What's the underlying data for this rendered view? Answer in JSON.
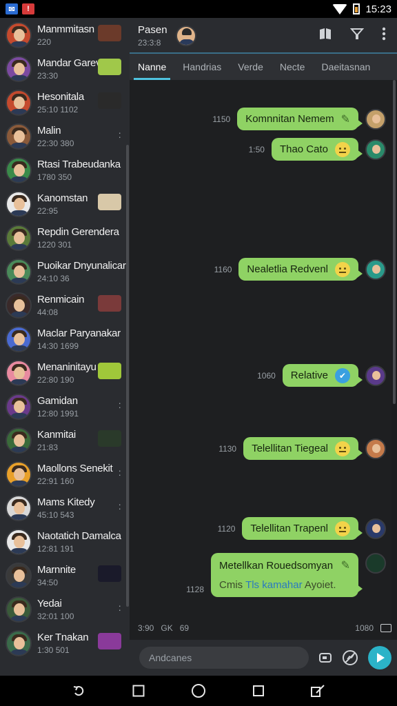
{
  "status_bar": {
    "time": "15:23"
  },
  "sidebar": {
    "chats": [
      {
        "name": "Manmmitasn",
        "meta": "220",
        "avatar_color": "#c44a2e",
        "thumb": "#6b3a2a",
        "dots": false
      },
      {
        "name": "Mandar Garev",
        "meta": "23:30",
        "avatar_color": "#7b4aa0",
        "thumb": "#a0c84a",
        "dots": false
      },
      {
        "name": "Hesonitala",
        "meta": "25:10 1102",
        "avatar_color": "#c44a2e",
        "thumb": "#2a2a2a",
        "dots": false
      },
      {
        "name": "Malin",
        "meta": "22:30 380",
        "avatar_color": "#8a5a3a",
        "thumb": "",
        "dots": true
      },
      {
        "name": "Rtasi Trabeudanka",
        "meta": "1780 350",
        "avatar_color": "#3a8a4a",
        "thumb": "",
        "dots": false
      },
      {
        "name": "Kanomstan",
        "meta": "22:95",
        "avatar_color": "#e8e8e8",
        "thumb": "#d8c8a8",
        "dots": false
      },
      {
        "name": "Repdin Gerendera",
        "meta": "1220 301",
        "avatar_color": "#5a7a3a",
        "thumb": "",
        "dots": false
      },
      {
        "name": "Puoikar Dnyunalicar",
        "meta": "24:10 36",
        "avatar_color": "#4a8a5a",
        "thumb": "",
        "dots": false
      },
      {
        "name": "Renmicain",
        "meta": "44:08",
        "avatar_color": "#3a2a2a",
        "thumb": "#7a3a3a",
        "dots": false
      },
      {
        "name": "Maclar Paryanakar",
        "meta": "14:30 1699",
        "avatar_color": "#4a6ad0",
        "thumb": "",
        "dots": false
      },
      {
        "name": "Menaninitayu",
        "meta": "22:80 190",
        "avatar_color": "#e88aa0",
        "thumb": "#a0c83a",
        "dots": false
      },
      {
        "name": "Gamidan",
        "meta": "12:80 1991",
        "avatar_color": "#6a3a8a",
        "thumb": "",
        "dots": true
      },
      {
        "name": "Kanmitai",
        "meta": "21:83",
        "avatar_color": "#3a6a3a",
        "thumb": "#2a3a2a",
        "dots": false
      },
      {
        "name": "Maollons Senekit",
        "meta": "22:91 160",
        "avatar_color": "#e8a02a",
        "thumb": "",
        "dots": true
      },
      {
        "name": "Mams Kitedy",
        "meta": "45:10 543",
        "avatar_color": "#d8d8d8",
        "thumb": "",
        "dots": true
      },
      {
        "name": "Naotatich Damalca",
        "meta": "12:81 191",
        "avatar_color": "#e8e8e8",
        "thumb": "",
        "dots": false
      },
      {
        "name": "Marnnite",
        "meta": "34:50",
        "avatar_color": "#3a3a3a",
        "thumb": "#1a1a2a",
        "dots": false
      },
      {
        "name": "Yedai",
        "meta": "32:01 100",
        "avatar_color": "#3a5a3a",
        "thumb": "",
        "dots": true
      },
      {
        "name": "Ker Tnakan",
        "meta": "1:30 501",
        "avatar_color": "#3a6a4a",
        "thumb": "#8a3a9a",
        "dots": false
      }
    ]
  },
  "header": {
    "name": "Pasen",
    "meta": "23:3:8"
  },
  "tabs": [
    "Nanne",
    "Handrias",
    "Verde",
    "Necte",
    "Daeitasnan"
  ],
  "messages": [
    {
      "time": "1150",
      "text": "Komnnitan Nemem",
      "badge": "pen",
      "avatar_color": "#c4a06a"
    },
    {
      "time": "1:50",
      "text": "Thao Cato",
      "badge": "emoji",
      "avatar_color": "#2a8a6a"
    },
    {
      "time": "1160",
      "text": "Nealetlia Redvenl",
      "badge": "emoji",
      "avatar_color": "#2a9a8a"
    },
    {
      "time": "1060",
      "text": "Relative",
      "badge": "check",
      "avatar_color": "#5a3a8a"
    },
    {
      "time": "1130",
      "text": "Telellitan Tiegeal",
      "badge": "emoji",
      "avatar_color": "#c47a4a"
    },
    {
      "time": "1120",
      "text": "Telellitan Trapenl",
      "badge": "emoji",
      "avatar_color": "#2a3a6a"
    }
  ],
  "last_message": {
    "time": "1128",
    "line1": "Metellkan Rouedsomyan",
    "line2_prefix": "Cmis ",
    "line2_highlight": "Tls kamahar",
    "line2_suffix": " Ayoiet."
  },
  "footer": {
    "left_time": "3:90",
    "left_label": "GK",
    "left_glyph": "69",
    "right_time": "1080"
  },
  "composer": {
    "placeholder": "Andcanes"
  },
  "icons": {
    "header": [
      "book-icon",
      "filter-icon",
      "more-icon"
    ],
    "composer": [
      "attach-icon",
      "mute-icon",
      "send-icon"
    ],
    "nav": [
      "back-icon",
      "square-icon",
      "home-icon",
      "recents-icon",
      "edit-icon"
    ]
  }
}
